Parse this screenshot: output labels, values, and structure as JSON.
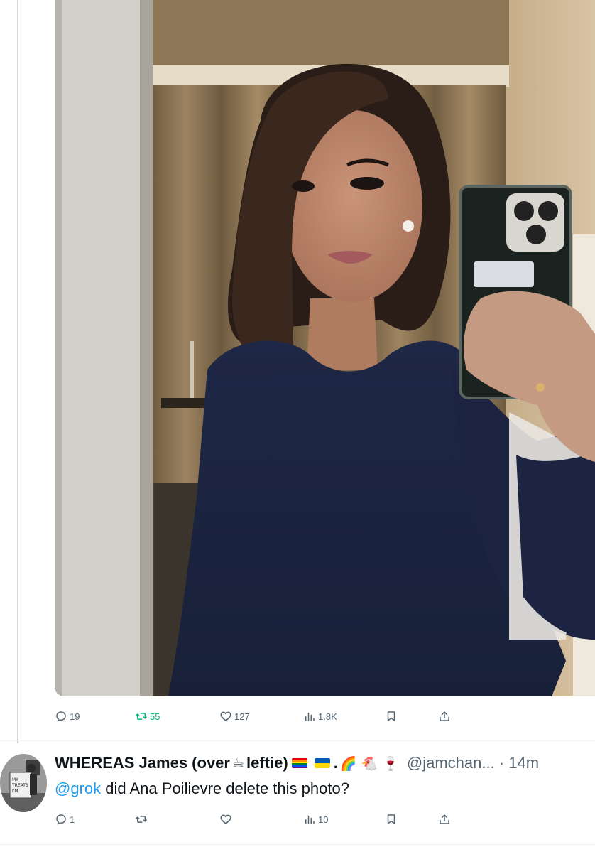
{
  "colors": {
    "text_primary": "#0f1419",
    "text_secondary": "#536471",
    "retweet_green": "#00ba7c",
    "mention_blue": "#1d9bf0",
    "divider": "#eff3f4"
  },
  "tweet": {
    "media": {
      "alt_icon": "photo-icon"
    },
    "actions": {
      "reply_count": "19",
      "retweet_count": "55",
      "like_count": "127",
      "view_count": "1.8K"
    }
  },
  "reply": {
    "display_name": "WHEREAS James (over",
    "name_suffix": "leftie)",
    "emojis": {
      "coffee": "☕",
      "rainbow": "🌈",
      "chicken": "🐔",
      "wine": "🍷"
    },
    "handle": "@jamchan... · 14m",
    "mention": "@grok",
    "text": " did Ana Poilievre delete this photo?",
    "actions": {
      "reply_count": "1",
      "retweet_count": "",
      "like_count": "",
      "view_count": "10"
    },
    "avatar_sign": "MY TREATS I'M"
  },
  "icons": [
    "reply-icon",
    "retweet-icon",
    "like-icon",
    "views-icon",
    "bookmark-icon",
    "share-icon"
  ]
}
